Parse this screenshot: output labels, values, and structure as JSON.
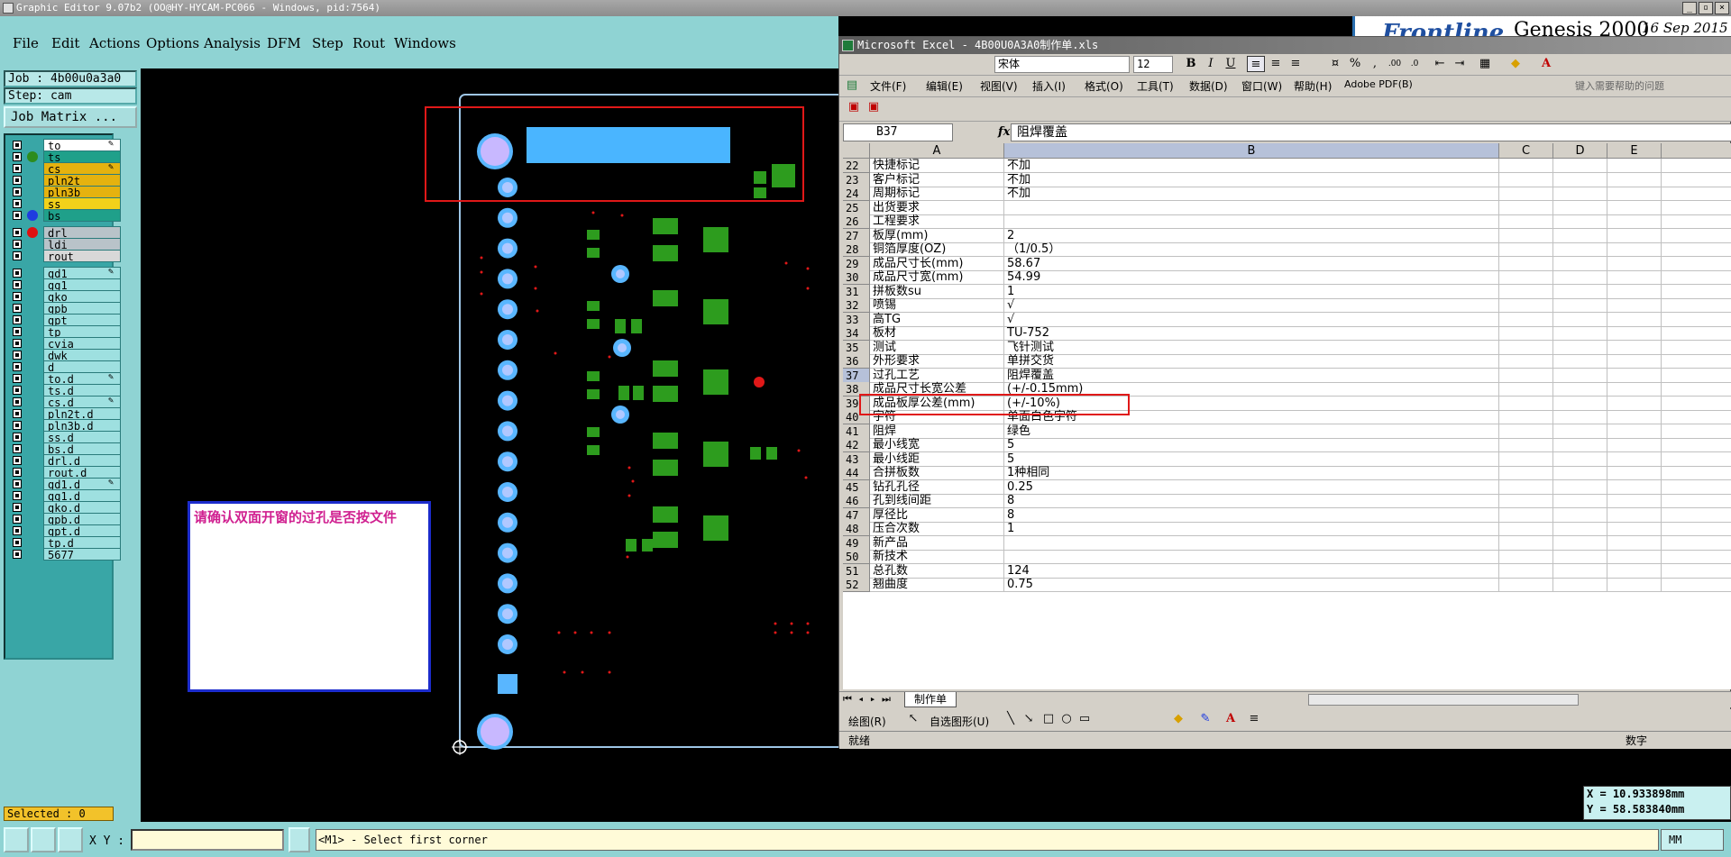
{
  "titlebar": {
    "text": "Graphic Editor 9.07b2 (OO@HY-HYCAM-PC066 - Windows, pid:7564)"
  },
  "menu": [
    "File",
    "Edit",
    "Actions",
    "Options",
    "Analysis",
    "DFM",
    "Step",
    "Rout",
    "Windows"
  ],
  "brand": {
    "logo": "Frontline",
    "product": "Genesis 2000",
    "date": "16 Sep 2015"
  },
  "job": {
    "job_label": "Job : 4b00u0a3a0",
    "step_label": "Step: cam",
    "matrix_button": "Job Matrix ..."
  },
  "layers": [
    {
      "name": "to",
      "bg": "#ffffff",
      "dot": "",
      "mark": "✎"
    },
    {
      "name": "ts",
      "bg": "#1fa08a",
      "dot": "#2d8c1e",
      "mark": ""
    },
    {
      "name": "cs",
      "bg": "#e5b20f",
      "dot": "",
      "mark": "✎"
    },
    {
      "name": "pln2t",
      "bg": "#e5b20f",
      "dot": "",
      "mark": ""
    },
    {
      "name": "pln3b",
      "bg": "#e5b20f",
      "dot": "",
      "mark": ""
    },
    {
      "name": "ss",
      "bg": "#f2d11a",
      "dot": "",
      "mark": ""
    },
    {
      "name": "bs",
      "bg": "#1fa08a",
      "dot": "#1f3ce0",
      "mark": ""
    },
    {
      "name": "drl",
      "bg": "#b9c3c9",
      "dot": "#e01010",
      "mark": "",
      "gap": true
    },
    {
      "name": "ldi",
      "bg": "#b9c3c9",
      "dot": "",
      "mark": ""
    },
    {
      "name": "rout",
      "bg": "#d8d8d8",
      "dot": "",
      "mark": ""
    },
    {
      "name": "gd1",
      "bg": "#9ee0e0",
      "dot": "",
      "mark": "✎",
      "gap": true
    },
    {
      "name": "gg1",
      "bg": "#9ee0e0",
      "dot": "",
      "mark": ""
    },
    {
      "name": "gko",
      "bg": "#9ee0e0",
      "dot": "",
      "mark": ""
    },
    {
      "name": "gpb",
      "bg": "#9ee0e0",
      "dot": "",
      "mark": ""
    },
    {
      "name": "gpt",
      "bg": "#9ee0e0",
      "dot": "",
      "mark": ""
    },
    {
      "name": "tp",
      "bg": "#9ee0e0",
      "dot": "",
      "mark": ""
    },
    {
      "name": "cvia",
      "bg": "#9ee0e0",
      "dot": "",
      "mark": ""
    },
    {
      "name": "dwk",
      "bg": "#9ee0e0",
      "dot": "",
      "mark": ""
    },
    {
      "name": "d",
      "bg": "#9ee0e0",
      "dot": "",
      "mark": ""
    },
    {
      "name": "to.d",
      "bg": "#9ee0e0",
      "dot": "",
      "mark": "✎"
    },
    {
      "name": "ts.d",
      "bg": "#9ee0e0",
      "dot": "",
      "mark": ""
    },
    {
      "name": "cs.d",
      "bg": "#9ee0e0",
      "dot": "",
      "mark": "✎"
    },
    {
      "name": "pln2t.d",
      "bg": "#9ee0e0",
      "dot": "",
      "mark": ""
    },
    {
      "name": "pln3b.d",
      "bg": "#9ee0e0",
      "dot": "",
      "mark": ""
    },
    {
      "name": "ss.d",
      "bg": "#9ee0e0",
      "dot": "",
      "mark": ""
    },
    {
      "name": "bs.d",
      "bg": "#9ee0e0",
      "dot": "",
      "mark": ""
    },
    {
      "name": "drl.d",
      "bg": "#9ee0e0",
      "dot": "",
      "mark": ""
    },
    {
      "name": "rout.d",
      "bg": "#9ee0e0",
      "dot": "",
      "mark": ""
    },
    {
      "name": "gd1.d",
      "bg": "#9ee0e0",
      "dot": "",
      "mark": "✎"
    },
    {
      "name": "gg1.d",
      "bg": "#9ee0e0",
      "dot": "",
      "mark": ""
    },
    {
      "name": "gko.d",
      "bg": "#9ee0e0",
      "dot": "",
      "mark": ""
    },
    {
      "name": "gpb.d",
      "bg": "#9ee0e0",
      "dot": "",
      "mark": ""
    },
    {
      "name": "gpt.d",
      "bg": "#9ee0e0",
      "dot": "",
      "mark": ""
    },
    {
      "name": "tp.d",
      "bg": "#9ee0e0",
      "dot": "",
      "mark": ""
    },
    {
      "name": "5677",
      "bg": "#9ee0e0",
      "dot": "",
      "mark": ""
    }
  ],
  "selected": "Selected : 0",
  "note": "请确认双面开窗的过孔是否按文件",
  "coords": {
    "x": "X = 10.933898mm",
    "y": "Y = 58.583840mm"
  },
  "bottom": {
    "xy_label": "X Y :",
    "prompt": "<M1> - Select first corner",
    "unit": "MM"
  },
  "excel": {
    "title": "Microsoft Excel - 4B00U0A3A0制作单.xls",
    "font_name": "宋体",
    "font_size": "12",
    "menus": [
      "文件(F)",
      "编辑(E)",
      "视图(V)",
      "插入(I)",
      "格式(O)",
      "工具(T)",
      "数据(D)",
      "窗口(W)",
      "帮助(H)",
      "Adobe PDF(B)"
    ],
    "help_hint": "键入需要帮助的问题",
    "name_box": "B37",
    "formula": "阻焊覆盖",
    "columns": [
      "A",
      "B",
      "C",
      "D",
      "E"
    ],
    "rows": [
      {
        "n": "22",
        "a": "快捷标记",
        "b": "不加"
      },
      {
        "n": "23",
        "a": "客户标记",
        "b": "不加"
      },
      {
        "n": "24",
        "a": "周期标记",
        "b": "不加"
      },
      {
        "n": "25",
        "a": "出货要求",
        "b": ""
      },
      {
        "n": "26",
        "a": "工程要求",
        "b": ""
      },
      {
        "n": "27",
        "a": "板厚(mm)",
        "b": "2"
      },
      {
        "n": "28",
        "a": "铜箔厚度(OZ)",
        "b": "（1/0.5）"
      },
      {
        "n": "29",
        "a": "成品尺寸长(mm)",
        "b": "58.67"
      },
      {
        "n": "30",
        "a": "成品尺寸宽(mm)",
        "b": "54.99"
      },
      {
        "n": "31",
        "a": "拼板数su",
        "b": "1"
      },
      {
        "n": "32",
        "a": "喷锡",
        "b": "√"
      },
      {
        "n": "33",
        "a": "高TG",
        "b": "√"
      },
      {
        "n": "34",
        "a": "板材",
        "b": "TU-752"
      },
      {
        "n": "35",
        "a": "测试",
        "b": "飞针测试"
      },
      {
        "n": "36",
        "a": "外形要求",
        "b": "单拼交货"
      },
      {
        "n": "37",
        "a": "过孔工艺",
        "b": "阻焊覆盖"
      },
      {
        "n": "38",
        "a": "成品尺寸长宽公差",
        "b": "(+/-0.15mm)"
      },
      {
        "n": "39",
        "a": "成品板厚公差(mm)",
        "b": "(+/-10%)"
      },
      {
        "n": "40",
        "a": "字符",
        "b": "单面白色字符"
      },
      {
        "n": "41",
        "a": "阻焊",
        "b": "绿色"
      },
      {
        "n": "42",
        "a": "最小线宽",
        "b": "5"
      },
      {
        "n": "43",
        "a": "最小线距",
        "b": "5"
      },
      {
        "n": "44",
        "a": "合拼板数",
        "b": "1种相同"
      },
      {
        "n": "45",
        "a": "钻孔孔径",
        "b": "0.25"
      },
      {
        "n": "46",
        "a": "孔到线间距",
        "b": "8"
      },
      {
        "n": "47",
        "a": "厚径比",
        "b": "8"
      },
      {
        "n": "48",
        "a": "压合次数",
        "b": "1"
      },
      {
        "n": "49",
        "a": "新产品",
        "b": ""
      },
      {
        "n": "50",
        "a": "新技术",
        "b": ""
      },
      {
        "n": "51",
        "a": "总孔数",
        "b": "124"
      },
      {
        "n": "52",
        "a": "翘曲度",
        "b": "0.75"
      }
    ],
    "sheet_tab": "制作单",
    "draw_label": "绘图(R)",
    "autoshape_label": "自选图形(U)",
    "status_ready": "就绪",
    "status_num": "数字"
  },
  "colors": {
    "pad": "#2d9c1e",
    "via": "#59b6ff",
    "via_core": "#b0c8ff",
    "highlight": "#e01818"
  }
}
